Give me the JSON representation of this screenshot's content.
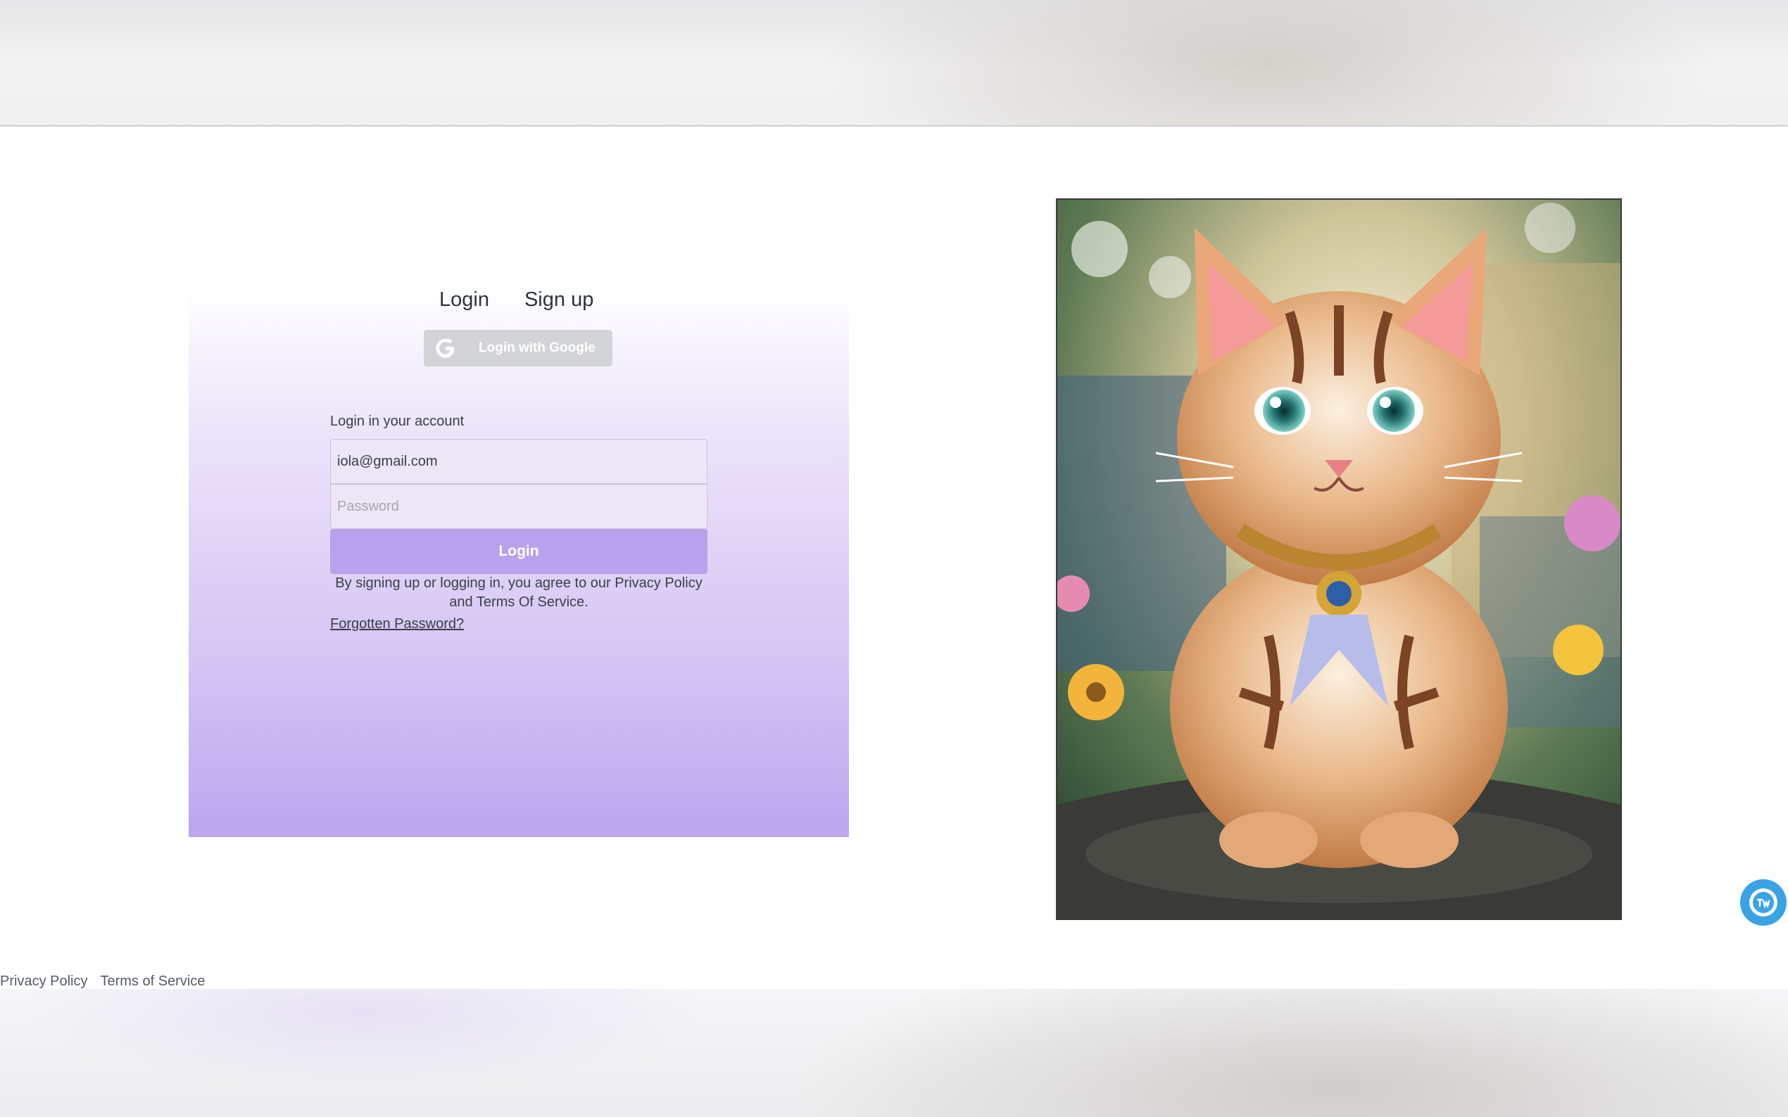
{
  "auth": {
    "tabs": [
      "Login",
      "Sign up"
    ],
    "google_button_label": "Login with Google",
    "form_title": "Login in your account",
    "email_value": "iola@gmail.com",
    "password_placeholder": "Password",
    "login_button_label": "Login",
    "agreement_line1": "By signing up or logging in, you agree to our Privacy Policy",
    "agreement_line2": "and Terms Of Service.",
    "forgot_password_label": "Forgotten Password?"
  },
  "footer": {
    "privacy_policy": "Privacy Policy",
    "terms_of_service": "Terms of Service"
  },
  "colors": {
    "accent": "#b8a2ec",
    "google_button": "#d3d4d8",
    "chat_widget": "#3aa3e6"
  },
  "icons": {
    "google": "google-g-icon",
    "chat": "chat-widget-icon"
  }
}
